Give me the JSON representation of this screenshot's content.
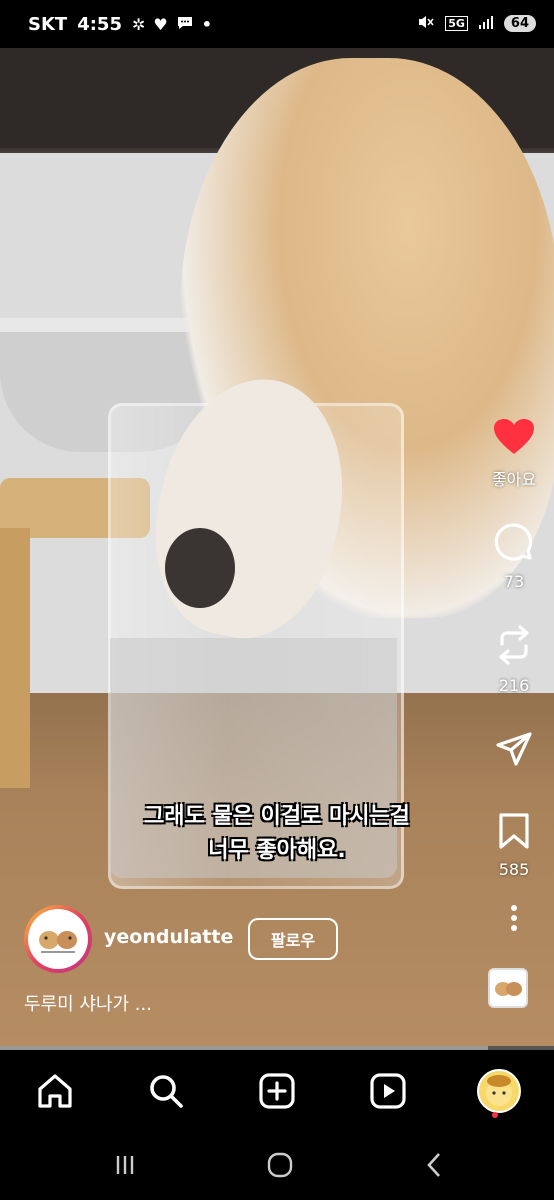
{
  "status_bar": {
    "carrier": "SKT",
    "time": "4:55",
    "network": "5G",
    "battery": "64",
    "notification_icons": [
      "pinwheel-icon",
      "heart-icon",
      "chat-bubble-icon",
      "dot-icon"
    ]
  },
  "video": {
    "subtitle_line1": "그래도 물은 이걸로 마시는걸",
    "subtitle_line2": "너무 좋아해요.",
    "progress_fraction": 0.88
  },
  "actions": {
    "like_label": "좋아요",
    "like_color": "#ff3040",
    "comment_count": "73",
    "repost_count": "216",
    "save_count": "585"
  },
  "author": {
    "username": "yeondulatte",
    "follow_label": "팔로우",
    "caption": "두루미 샤나가 ..."
  },
  "bottom_nav": {
    "items": [
      "home-icon",
      "search-icon",
      "create-icon",
      "reels-icon",
      "profile-icon"
    ]
  },
  "colors": {
    "accent_red": "#ff3040",
    "background": "#000000"
  }
}
